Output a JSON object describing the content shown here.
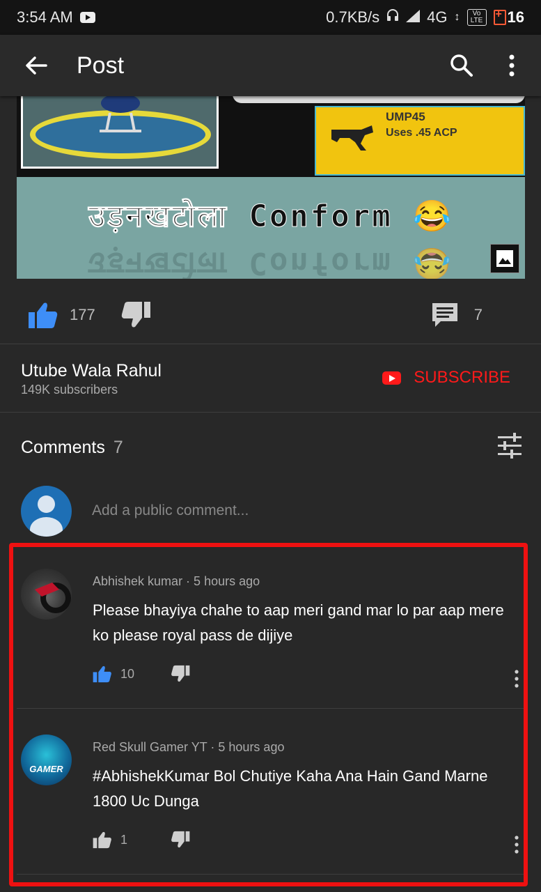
{
  "status_bar": {
    "time": "3:54 AM",
    "network_speed": "0.7KB/s",
    "network_type": "4G",
    "volte": "Vo LTE",
    "battery": "16"
  },
  "app_bar": {
    "title": "Post"
  },
  "post": {
    "image": {
      "weapon_name": "UMP45",
      "weapon_sub": "Uses .45 ACP",
      "banner_text": "उड़नखटोला Conform 😂"
    },
    "likes": "177",
    "comments_count": "7"
  },
  "channel": {
    "name": "Utube Wala Rahul",
    "subscribers": "149K subscribers",
    "subscribe_label": "SUBSCRIBE"
  },
  "comments_section": {
    "title": "Comments",
    "count": "7",
    "add_placeholder": "Add a public comment..."
  },
  "comments": [
    {
      "author": "Abhishek kumar",
      "time": "5 hours ago",
      "meta": "Abhishek kumar · 5 hours ago",
      "text": "Please bhayiya chahe to aap meri gand mar lo par aap mere ko please royal pass de dijiye",
      "likes": "10",
      "liked": true
    },
    {
      "author": "Red Skull Gamer YT",
      "time": "5 hours ago",
      "meta": "Red Skull Gamer YT · 5 hours ago",
      "text": "#AbhishekKumar Bol Chutiye Kaha Ana Hain Gand Marne 1800 Uc Dunga",
      "likes": "1",
      "liked": false,
      "avatar_text": "GAMER"
    }
  ],
  "colors": {
    "background": "#282828",
    "accent_blue": "#3e8ef7",
    "subscribe_red": "#ff1a1a",
    "highlight_red": "#ee1111"
  }
}
